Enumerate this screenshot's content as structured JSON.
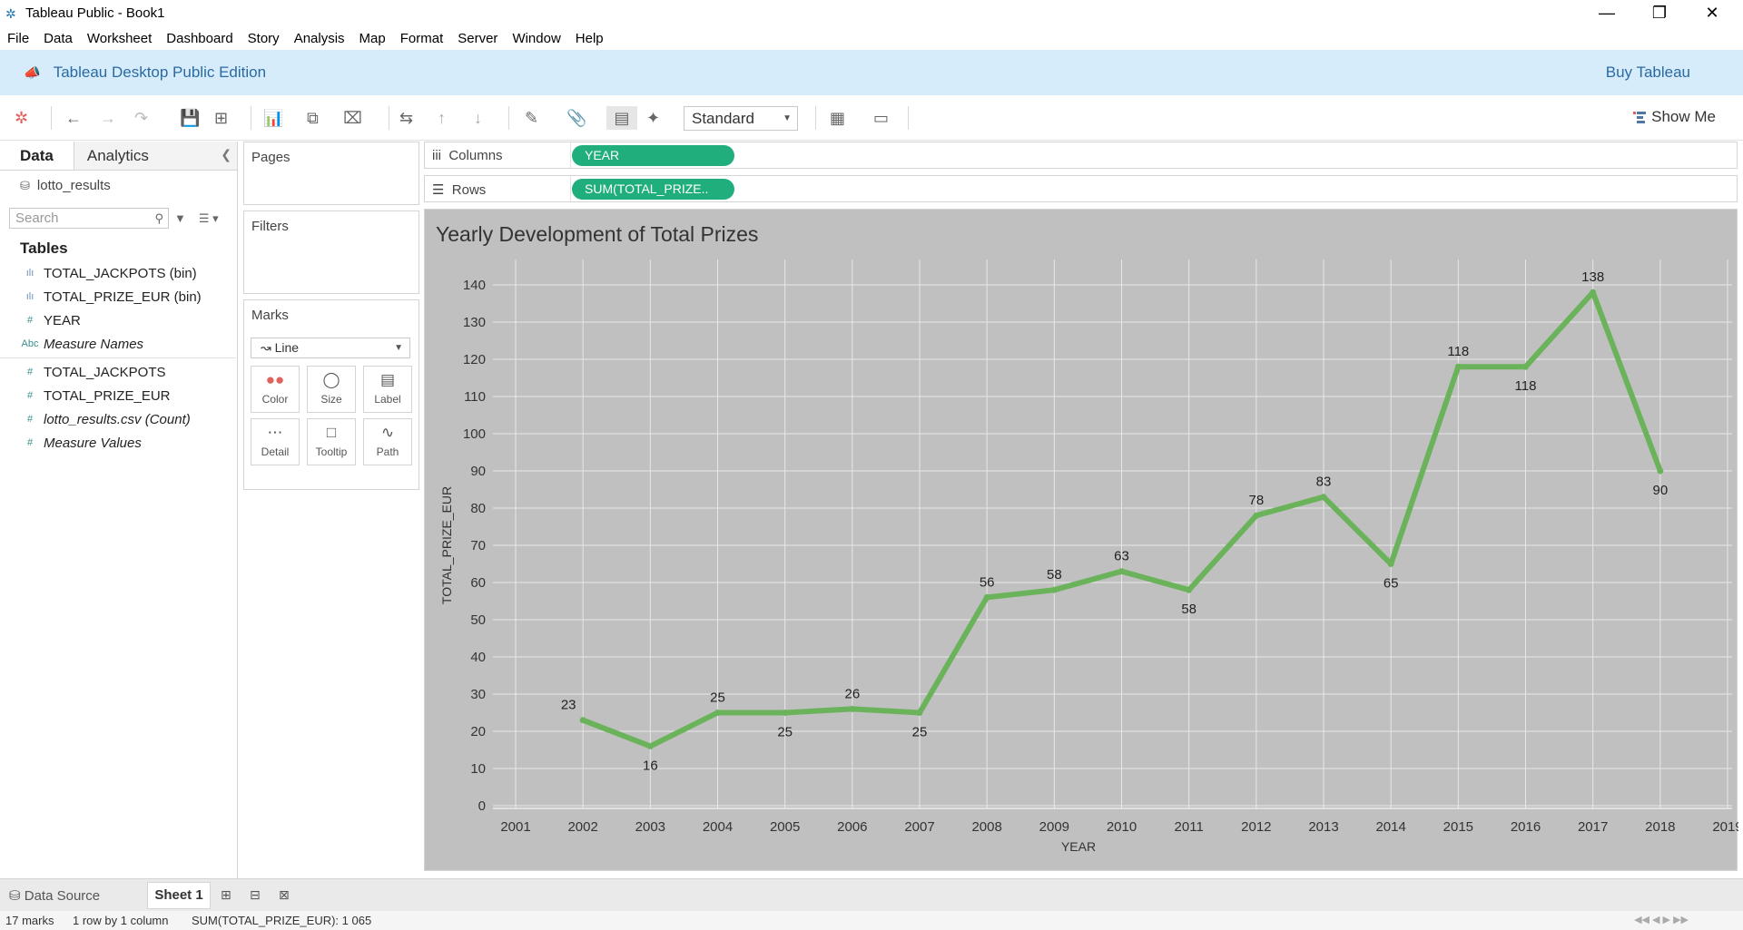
{
  "window": {
    "title": "Tableau Public - Book1"
  },
  "menu": [
    "File",
    "Data",
    "Worksheet",
    "Dashboard",
    "Story",
    "Analysis",
    "Map",
    "Format",
    "Server",
    "Window",
    "Help"
  ],
  "banner": {
    "text": "Tableau Desktop Public Edition",
    "buy": "Buy Tableau"
  },
  "toolbar": {
    "fit_value": "Standard",
    "show_me": "Show Me"
  },
  "left": {
    "tabs": [
      "Data",
      "Analytics"
    ],
    "datasource": "lotto_results",
    "search_placeholder": "Search",
    "tables_title": "Tables",
    "fields": [
      {
        "icon": "bin-icon",
        "glyph": "ılı",
        "name": "TOTAL_JACKPOTS (bin)",
        "italic": false
      },
      {
        "icon": "bin-icon",
        "glyph": "ılı",
        "name": "TOTAL_PRIZE_EUR (bin)",
        "italic": false
      },
      {
        "icon": "number-icon",
        "glyph": "#",
        "name": "YEAR",
        "italic": false
      },
      {
        "icon": "string-icon",
        "glyph": "Abc",
        "name": "Measure Names",
        "italic": true
      },
      {
        "icon": "number-icon",
        "glyph": "#",
        "name": "TOTAL_JACKPOTS",
        "italic": false
      },
      {
        "icon": "number-icon",
        "glyph": "#",
        "name": "TOTAL_PRIZE_EUR",
        "italic": false
      },
      {
        "icon": "number-icon",
        "glyph": "#",
        "name": "lotto_results.csv (Count)",
        "italic": true
      },
      {
        "icon": "number-icon",
        "glyph": "#",
        "name": "Measure Values",
        "italic": true
      }
    ]
  },
  "cards": {
    "pages": "Pages",
    "filters": "Filters",
    "marks": "Marks",
    "mark_type": "Line",
    "mark_buttons": [
      "Color",
      "Size",
      "Label",
      "Detail",
      "Tooltip",
      "Path"
    ]
  },
  "shelves": {
    "columns_label": "Columns",
    "columns_pill": "YEAR",
    "rows_label": "Rows",
    "rows_pill": "SUM(TOTAL_PRIZE.."
  },
  "chart_data": {
    "type": "line",
    "title": "Yearly Development of Total Prizes",
    "xlabel": "YEAR",
    "ylabel": "TOTAL_PRIZE_EUR",
    "x_ticks": [
      "2001",
      "2002",
      "2003",
      "2004",
      "2005",
      "2006",
      "2007",
      "2008",
      "2009",
      "2010",
      "2011",
      "2012",
      "2013",
      "2014",
      "2015",
      "2016",
      "2017",
      "2018",
      "2019"
    ],
    "y_ticks": [
      0,
      10,
      20,
      30,
      40,
      50,
      60,
      70,
      80,
      90,
      100,
      110,
      120,
      130,
      140
    ],
    "xlim": [
      2001,
      2019
    ],
    "ylim": [
      0,
      140
    ],
    "grid": true,
    "color": "#6bb35a",
    "series": [
      {
        "x": [
          2002,
          2003,
          2004,
          2005,
          2006,
          2007,
          2008,
          2009,
          2010,
          2011,
          2012,
          2013,
          2014,
          2015,
          2016,
          2017,
          2018
        ],
        "values": [
          23,
          16,
          25,
          25,
          26,
          25,
          56,
          58,
          63,
          58,
          78,
          83,
          65,
          118,
          118,
          138,
          90
        ]
      }
    ]
  },
  "sheets": {
    "data_source": "Data Source",
    "active_sheet": "Sheet 1"
  },
  "status": {
    "marks": "17 marks",
    "dims": "1 row by 1 column",
    "sum": "SUM(TOTAL_PRIZE_EUR): 1 065"
  }
}
